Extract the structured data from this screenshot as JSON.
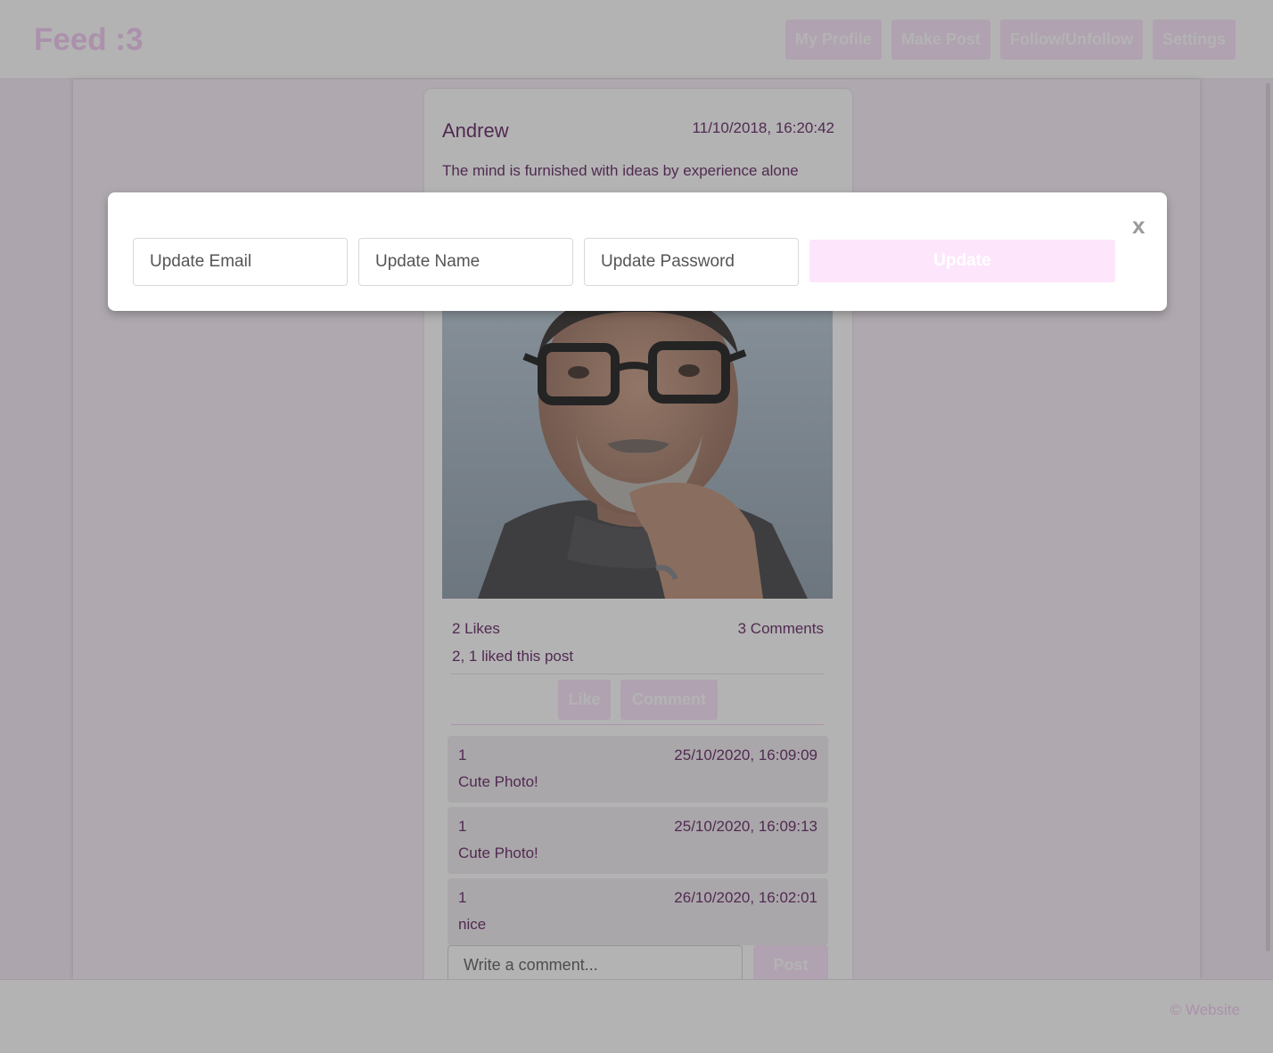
{
  "header": {
    "logo": "Feed :3",
    "nav": [
      "My Profile",
      "Make Post",
      "Follow/Unfollow",
      "Settings"
    ]
  },
  "post": {
    "author": "Andrew",
    "timestamp": "11/10/2018, 16:20:42",
    "text": "The mind is furnished with ideas by experience alone",
    "likes": "2 Likes",
    "comments_count": "3 Comments",
    "liked_by": "2, 1 liked this post",
    "like_label": "Like",
    "comment_label": "Comment",
    "comments": [
      {
        "user": "1",
        "time": "25/10/2020, 16:09:09",
        "text": "Cute Photo!"
      },
      {
        "user": "1",
        "time": "25/10/2020, 16:09:13",
        "text": "Cute Photo!"
      },
      {
        "user": "1",
        "time": "26/10/2020, 16:02:01",
        "text": "nice"
      }
    ],
    "comment_placeholder": "Write a comment...",
    "post_label": "Post"
  },
  "footer": {
    "text": "© Website"
  },
  "modal": {
    "email_placeholder": "Update Email",
    "name_placeholder": "Update Name",
    "password_placeholder": "Update Password",
    "update_label": "Update",
    "close_label": "x"
  },
  "colors": {
    "accent": "#f2c6f2",
    "button_bg": "#fbe3fb",
    "text": "#5a1a5a",
    "overlay": "rgba(64,64,64,0.4)"
  }
}
